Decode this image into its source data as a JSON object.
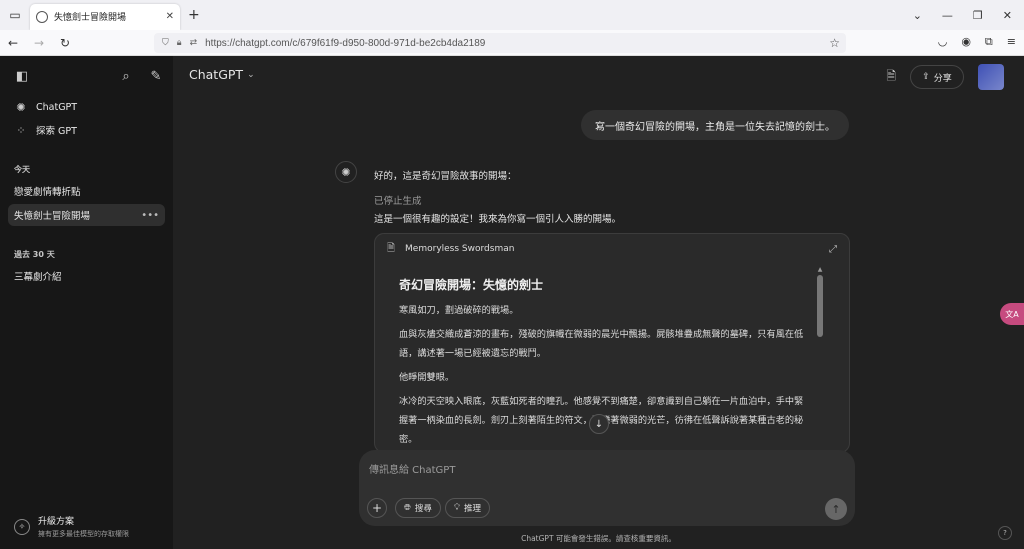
{
  "browser": {
    "tab_title": "失憶劍士冒險開場",
    "url": "https://chatgpt.com/c/679f61f9-d950-800d-971d-be2cb4da2189"
  },
  "sidebar": {
    "items": [
      {
        "label": "ChatGPT",
        "icon": "openai-logo-icon"
      },
      {
        "label": "探索 GPT",
        "icon": "grid-icon"
      }
    ],
    "today_label": "今天",
    "today_chats": [
      "戀愛劇情轉折點",
      "失憶劍士冒險開場"
    ],
    "past30_label": "過去 30 天",
    "past30_chats": [
      "三幕劇介紹"
    ],
    "upgrade_title": "升級方案",
    "upgrade_subtitle": "擁有更多最佳模型的存取權限"
  },
  "header": {
    "model": "ChatGPT",
    "share_label": "分享"
  },
  "conversation": {
    "user_message": "寫一個奇幻冒險的開場，主角是一位失去記憶的劍士。",
    "bot_intro": "好的，這是奇幻冒險故事的開場：",
    "stopped": "已停止生成",
    "bot_line2": "這是一個很有趣的設定！我來為你寫一個引人入勝的開場。",
    "canvas": {
      "doc_name": "Memoryless Swordsman",
      "title": "奇幻冒險開場：失憶的劍士",
      "paragraphs": [
        "寒風如刀，劃過破碎的戰場。",
        "血與灰燼交織成蒼涼的畫布，殘破的旗幟在微弱的晨光中飄揚。屍骸堆疊成無聲的墓碑，只有風在低語，講述著一場已經被遺忘的戰鬥。",
        "他睜開雙眼。",
        "冰冷的天空映入眼底，灰藍如死者的瞳孔。他感覺不到痛楚，卻意識到自己躺在一片血泊中，手中緊握著一柄染血的長劍。劍刃上刻著陌生的符文，閃爍著微弱的光芒，彷彿在低聲訴說著某種古老的秘密。"
      ]
    }
  },
  "composer": {
    "placeholder": "傳訊息給 ChatGPT",
    "search_label": "搜尋",
    "reason_label": "推理"
  },
  "disclaimer": "ChatGPT 可能會發生錯誤。請查核重要資訊。",
  "side_tag": "文A",
  "help": "?"
}
